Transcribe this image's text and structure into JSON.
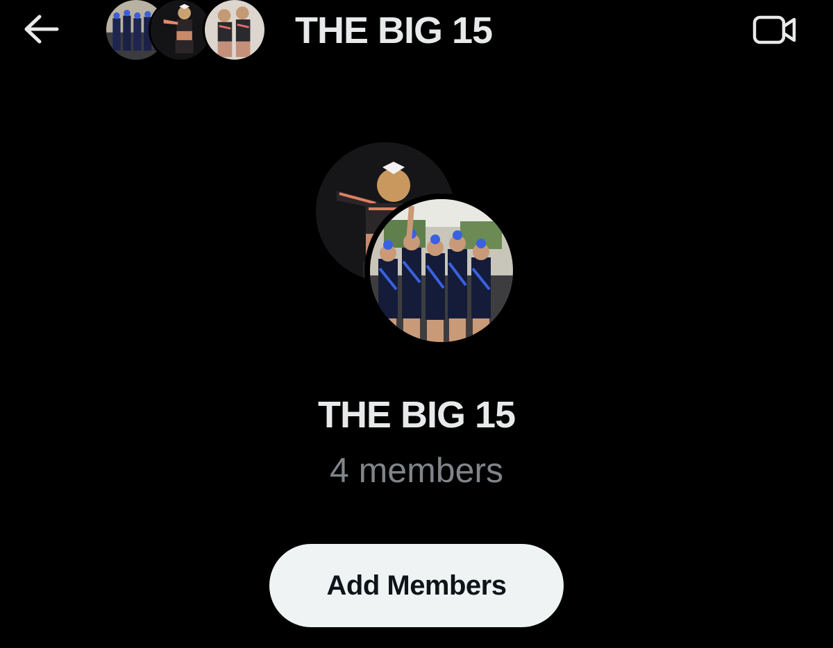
{
  "header": {
    "title": "THE BIG 15",
    "back_icon": "arrow-left-icon",
    "video_icon": "video-camera-icon"
  },
  "group": {
    "name": "THE BIG 15",
    "member_count": "4 members"
  },
  "actions": {
    "add_members_label": "Add Members"
  },
  "colors": {
    "background": "#000000",
    "primary_text": "#e7e9ea",
    "secondary_text": "#808589",
    "button_bg": "#eff3f4",
    "button_text": "#0f1419"
  }
}
